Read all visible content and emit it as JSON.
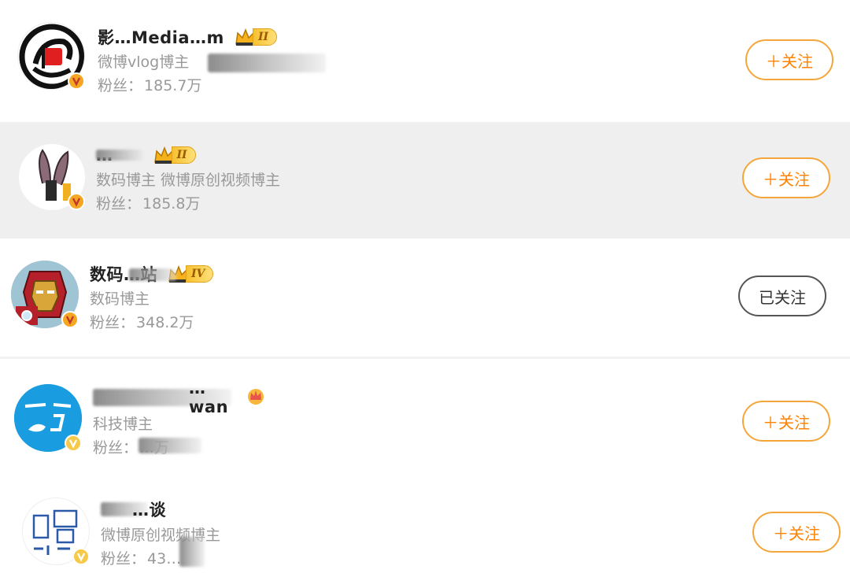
{
  "users": [
    {
      "name": "影…Media…m",
      "rank": "II",
      "desc": "微博vlog博主",
      "fans_label": "粉丝：",
      "fans_value": "185.7万",
      "button": "＋关注",
      "avatar_icon": "red-book-logo-icon",
      "badge_color": "#f5a623"
    },
    {
      "name": "…",
      "rank": "II",
      "desc": "数码博主 微博原创视频博主",
      "fans_label": "粉丝：",
      "fans_value": "185.8万",
      "button": "＋关注",
      "avatar_icon": "bunny-ears-icon",
      "badge_color": "#f5a623"
    },
    {
      "name": "数码…站",
      "rank": "IV",
      "desc": "数码博主",
      "fans_label": "粉丝：",
      "fans_value": "348.2万",
      "button": "已关注",
      "avatar_icon": "iron-man-icon",
      "badge_color": "#f5a623"
    },
    {
      "name": "…wan",
      "rank": "",
      "desc": "科技博主",
      "fans_label": "粉丝：",
      "fans_value": "…万",
      "button": "＋关注",
      "avatar_icon": "blue-logo-icon",
      "badge_color": "#f7c948"
    },
    {
      "name": "…谈",
      "rank": "",
      "desc": "微博原创视频博主",
      "fans_label": "粉丝：",
      "fans_value": "43…",
      "button": "＋关注",
      "avatar_icon": "sketch-logo-icon",
      "badge_color": "#f7c948"
    }
  ],
  "colors": {
    "accent": "#ff8200",
    "follow_border": "#f5a63a",
    "highlight_bg": "#efefef",
    "secondary_text": "#999999"
  }
}
